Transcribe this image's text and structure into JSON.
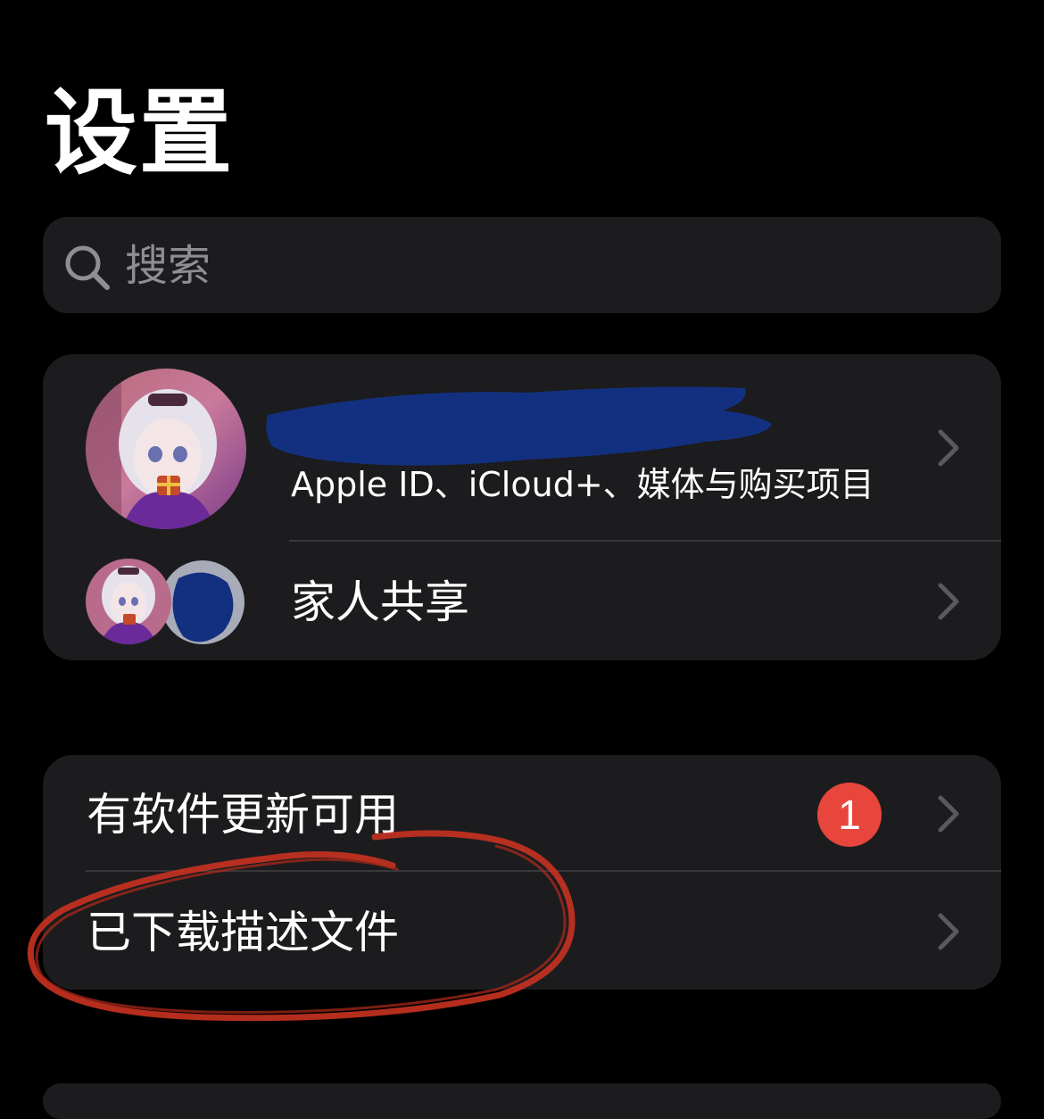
{
  "header": {
    "title": "设置"
  },
  "search": {
    "placeholder": "搜索"
  },
  "account": {
    "name": "",
    "subtitle": "Apple ID、iCloud+、媒体与购买项目"
  },
  "family": {
    "label": "家人共享"
  },
  "updates": {
    "label": "有软件更新可用",
    "badge_count": "1",
    "badge_color": "#e8453c"
  },
  "profiles": {
    "label": "已下载描述文件"
  },
  "colors": {
    "background": "#000000",
    "cell_background": "#1c1c1e",
    "separator": "#38383a",
    "secondary_text": "#8e8e93",
    "redaction": "#133080",
    "annotation": "#c93220"
  },
  "icons": {
    "search": "search-icon",
    "chevron": "chevron-right-icon"
  }
}
